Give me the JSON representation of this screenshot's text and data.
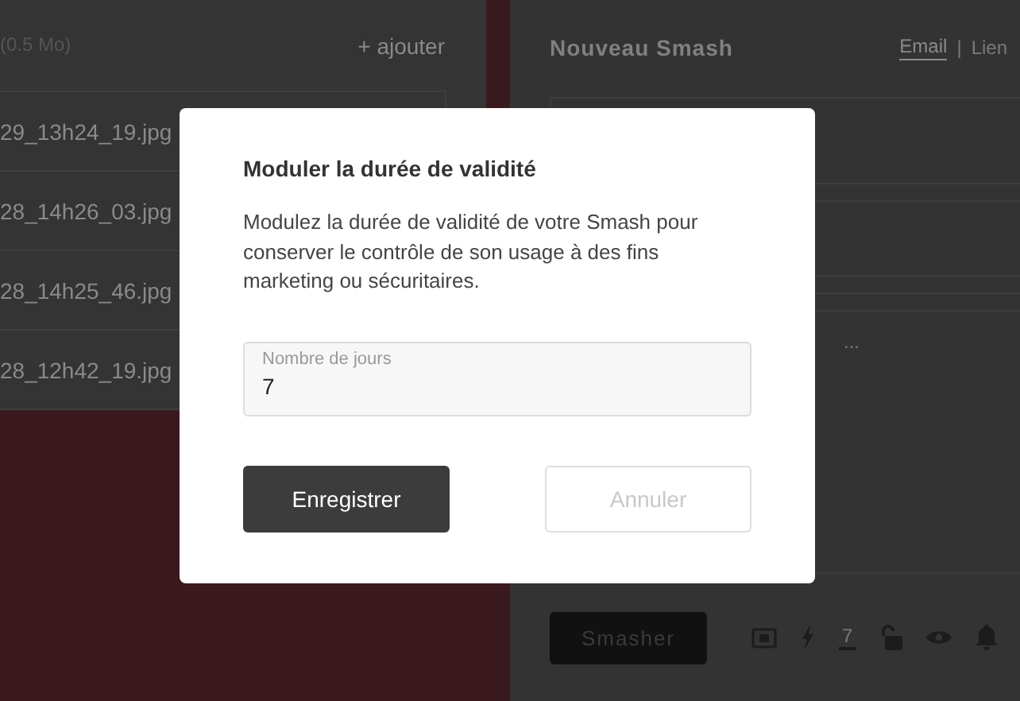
{
  "upload_panel": {
    "size": "(0.5 Mo)",
    "add_link": "+ ajouter",
    "files": [
      "29_13h24_19.jpg",
      "28_14h26_03.jpg",
      "28_14h25_46.jpg",
      "28_12h42_19.jpg"
    ]
  },
  "smash_panel": {
    "title": "Nouveau Smash",
    "modes": [
      {
        "label": "Email",
        "selected": true
      },
      {
        "label": "Lien",
        "selected": false
      }
    ],
    "separator": "|",
    "field_hint": "...",
    "submit": "Smasher",
    "tools": [
      {
        "kind": "screen"
      },
      {
        "kind": "flash"
      },
      {
        "kind": "days",
        "label": "7"
      },
      {
        "kind": "lock"
      },
      {
        "kind": "eye"
      },
      {
        "kind": "bell"
      }
    ]
  },
  "dialog": {
    "title": "Moduler la durée de validité",
    "text": "Modulez la durée de validité de votre Smash pour conserver le contrôle de son usage à des fins marketing ou sécuritaires.",
    "field": {
      "label": "Nombre de jours",
      "value": "7"
    },
    "buttons": [
      {
        "label": "Enregistrer",
        "kind": "primary"
      },
      {
        "label": "Annuler",
        "kind": "secondary"
      }
    ]
  }
}
